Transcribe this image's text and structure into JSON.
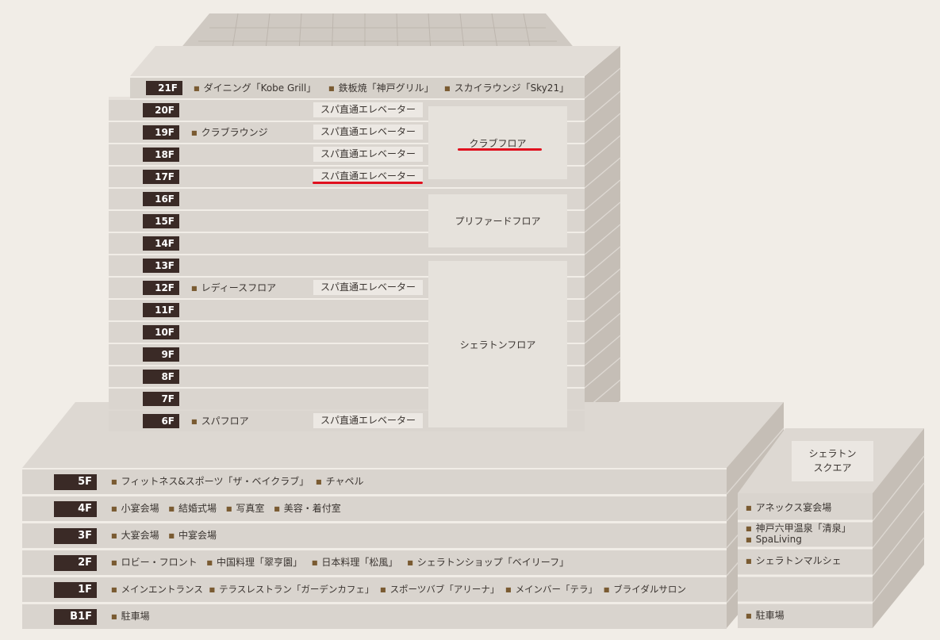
{
  "tower": {
    "top_floor": {
      "floor": "21F",
      "items": [
        "ダイニング「Kobe Grill」",
        "鉄板焼「神戸グリル」",
        "スカイラウンジ「Sky21」"
      ]
    },
    "floors": [
      {
        "floor": "20F",
        "facility": "",
        "elevator": "スパ直通エレベーター"
      },
      {
        "floor": "19F",
        "facility": "クラブラウンジ",
        "elevator": "スパ直通エレベーター"
      },
      {
        "floor": "18F",
        "facility": "",
        "elevator": "スパ直通エレベーター"
      },
      {
        "floor": "17F",
        "facility": "",
        "elevator": "スパ直通エレベーター",
        "highlighted": true
      },
      {
        "floor": "16F",
        "facility": "",
        "elevator": ""
      },
      {
        "floor": "15F",
        "facility": "",
        "elevator": ""
      },
      {
        "floor": "14F",
        "facility": "",
        "elevator": ""
      },
      {
        "floor": "13F",
        "facility": "",
        "elevator": ""
      },
      {
        "floor": "12F",
        "facility": "レディースフロア",
        "elevator": "スパ直通エレベーター"
      },
      {
        "floor": "11F",
        "facility": "",
        "elevator": ""
      },
      {
        "floor": "10F",
        "facility": "",
        "elevator": ""
      },
      {
        "floor": "9F",
        "facility": "",
        "elevator": ""
      },
      {
        "floor": "8F",
        "facility": "",
        "elevator": ""
      },
      {
        "floor": "7F",
        "facility": "",
        "elevator": ""
      },
      {
        "floor": "6F",
        "facility": "スパフロア",
        "elevator": "スパ直通エレベーター"
      }
    ],
    "zones": {
      "club": "クラブフロア",
      "preferred": "プリファードフロア",
      "sheraton": "シェラトンフロア"
    }
  },
  "podium": {
    "floors": [
      {
        "floor": "5F",
        "items": [
          "フィットネス&スポーツ「ザ・ベイクラブ」",
          "チャペル"
        ]
      },
      {
        "floor": "4F",
        "items": [
          "小宴会場",
          "結婚式場",
          "写真室",
          "美容・着付室"
        ]
      },
      {
        "floor": "3F",
        "items": [
          "大宴会場",
          "中宴会場"
        ]
      },
      {
        "floor": "2F",
        "items": [
          "ロビー・フロント",
          "中国料理「翠亨園」",
          "日本料理「松風」",
          "シェラトンショップ「ベイリーフ」"
        ]
      },
      {
        "floor": "1F",
        "items": [
          "メインエントランス",
          "テラスレストラン「ガーデンカフェ」",
          "スポーツバブ「アリーナ」",
          "メインバー「テラ」",
          "ブライダルサロン"
        ]
      },
      {
        "floor": "B1F",
        "items": [
          "駐車場"
        ]
      }
    ]
  },
  "annex": {
    "name_line1": "シェラトン",
    "name_line2": "スクエア",
    "items": {
      "4F": [
        "アネックス宴会場"
      ],
      "3F": [
        "神戸六甲温泉「清泉」",
        "SpaLiving"
      ],
      "2F": [
        "シェラトンマルシェ"
      ],
      "1F": [],
      "B1F": [
        "駐車場"
      ]
    }
  },
  "colors": {
    "background": "#f1ede7",
    "floor_tag": "#3a2a26",
    "bullet": "#7a5b32",
    "highlight_underline": "#e0101e"
  }
}
